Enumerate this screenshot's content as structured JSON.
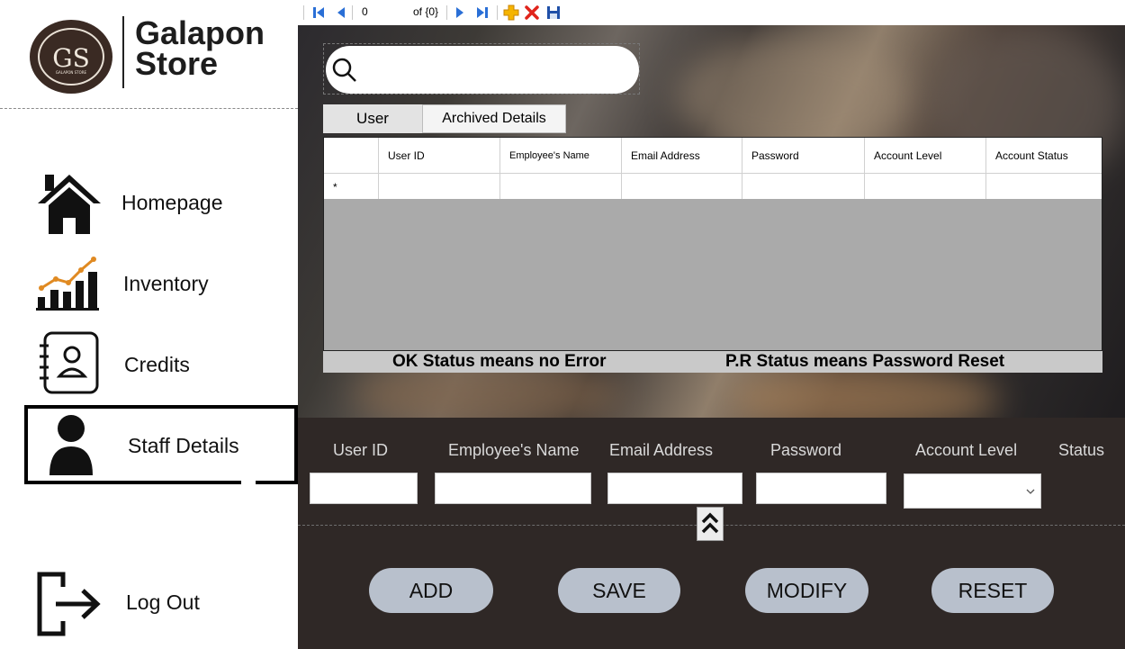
{
  "brand": {
    "line1": "Galapon",
    "line2": "Store",
    "logo_initials": "GS",
    "logo_subtext": "GALAPON STORE"
  },
  "sidebar": {
    "items": [
      {
        "label": "Homepage",
        "icon": "home-icon"
      },
      {
        "label": "Inventory",
        "icon": "chart-icon"
      },
      {
        "label": "Credits",
        "icon": "contact-book-icon"
      },
      {
        "label": "Staff Details",
        "icon": "user-icon",
        "selected": true
      },
      {
        "label": "Log Out",
        "icon": "logout-icon"
      }
    ]
  },
  "navigator": {
    "position": "0",
    "count_label": "of {0}"
  },
  "search": {
    "placeholder": ""
  },
  "tabs": [
    {
      "label": "User"
    },
    {
      "label": "Archived Details"
    }
  ],
  "grid": {
    "columns": [
      "User ID",
      "Employee's Name",
      "Email Address",
      "Password",
      "Account Level",
      "Account Status"
    ],
    "new_row_marker": "*"
  },
  "status_notes": {
    "ok": "OK Status means no Error",
    "pr": "P.R Status means Password Reset"
  },
  "form": {
    "labels": {
      "user_id": "User ID",
      "employee_name": "Employee's Name",
      "email": "Email Address",
      "password": "Password",
      "account_level": "Account Level",
      "status": "Status"
    },
    "values": {
      "user_id": "",
      "employee_name": "",
      "email": "",
      "password": "",
      "account_level": ""
    }
  },
  "buttons": {
    "add": "ADD",
    "save": "SAVE",
    "modify": "MODIFY",
    "reset": "RESET"
  },
  "colors": {
    "dark_panel": "#2f2826",
    "button": "#b8c0cc",
    "grid_empty": "#aaaaaa",
    "status_bar": "#c9c9c9"
  }
}
